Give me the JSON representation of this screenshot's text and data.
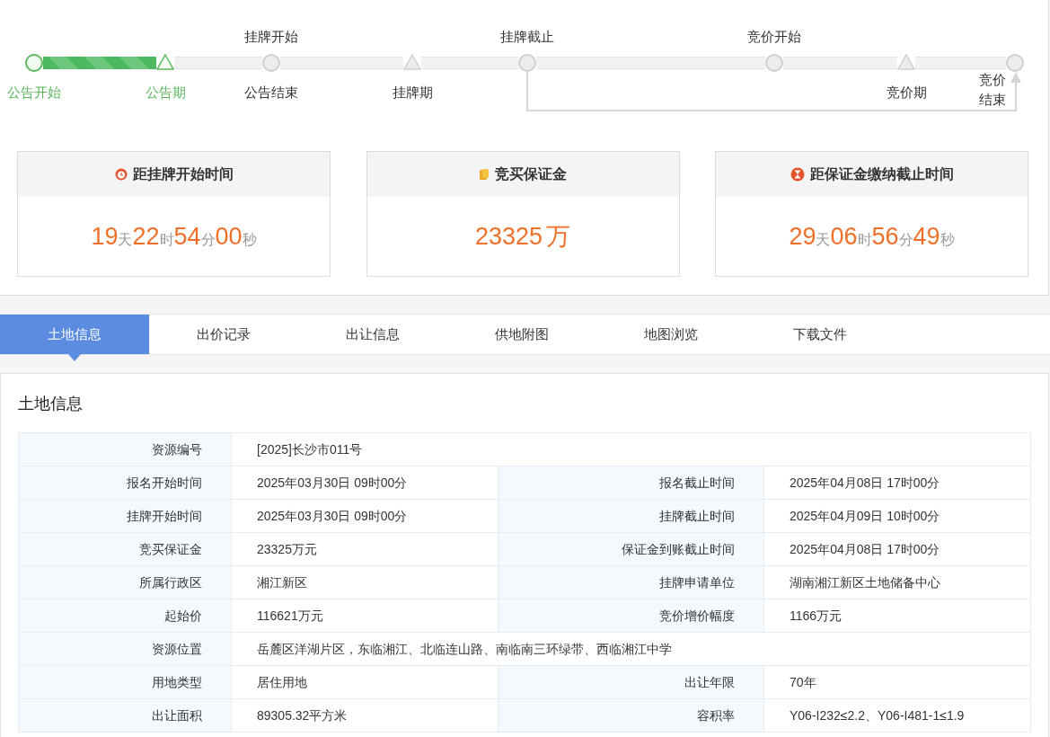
{
  "timeline": {
    "progress": {
      "level": 0.134
    },
    "nodes": [
      {
        "kind": "point",
        "below": "公告开始",
        "done": true
      },
      {
        "kind": "period",
        "below": "公告期",
        "done": true
      },
      {
        "kind": "point",
        "above": "挂牌开始",
        "below": "公告结束",
        "done": false
      },
      {
        "kind": "period",
        "below": "挂牌期",
        "done": false
      },
      {
        "kind": "point",
        "above": "挂牌截止",
        "done": false
      },
      {
        "kind": "point",
        "above": "竞价开始",
        "done": false
      },
      {
        "kind": "period",
        "below": "竞价期",
        "done": false
      },
      {
        "kind": "end",
        "below": "竞价结束",
        "done": false
      }
    ]
  },
  "cards": [
    {
      "kind": "countdown",
      "title": "距挂牌开始时间",
      "parts": [
        {
          "num": "19",
          "unit": "天"
        },
        {
          "num": "22",
          "unit": "时"
        },
        {
          "num": "54",
          "unit": "分"
        },
        {
          "num": "00",
          "unit": "秒"
        }
      ]
    },
    {
      "kind": "amount",
      "title": "竞买保证金",
      "parts": [
        {
          "num": "23325",
          "unit": "万"
        }
      ]
    },
    {
      "kind": "countdown",
      "title": "距保证金缴纳截止时间",
      "parts": [
        {
          "num": "29",
          "unit": "天"
        },
        {
          "num": "06",
          "unit": "时"
        },
        {
          "num": "56",
          "unit": "分"
        },
        {
          "num": "49",
          "unit": "秒"
        }
      ]
    }
  ],
  "tabs": [
    {
      "label": "土地信息",
      "selected": true
    },
    {
      "label": "出价记录",
      "selected": false
    },
    {
      "label": "出让信息",
      "selected": false
    },
    {
      "label": "供地附图",
      "selected": false
    },
    {
      "label": "地图浏览",
      "selected": false
    },
    {
      "label": "下载文件",
      "selected": false
    }
  ],
  "section_title": "土地信息",
  "table": {
    "rows": [
      [
        [
          "资源编号",
          "[2025]长沙市011号"
        ]
      ],
      [
        [
          "报名开始时间",
          "2025年03月30日 09时00分"
        ],
        [
          "报名截止时间",
          "2025年04月08日 17时00分"
        ]
      ],
      [
        [
          "挂牌开始时间",
          "2025年03月30日 09时00分"
        ],
        [
          "挂牌截止时间",
          "2025年04月09日 10时00分"
        ]
      ],
      [
        [
          "竞买保证金",
          "23325万元"
        ],
        [
          "保证金到账截止时间",
          "2025年04月08日 17时00分"
        ]
      ],
      [
        [
          "所属行政区",
          "湘江新区"
        ],
        [
          "挂牌申请单位",
          "湖南湘江新区土地储备中心"
        ]
      ],
      [
        [
          "起始价",
          "116621万元"
        ],
        [
          "竞价增价幅度",
          "1166万元"
        ]
      ],
      [
        [
          "资源位置",
          "岳麓区洋湖片区，东临湘江、北临连山路、南临南三环绿带、西临湘江中学"
        ]
      ],
      [
        [
          "用地类型",
          "居住用地"
        ],
        [
          "出让年限",
          "70年"
        ]
      ],
      [
        [
          "出让面积",
          "89305.32平方米"
        ],
        [
          "容积率",
          "Y06-I232≤2.2、Y06-I481-1≤1.9"
        ]
      ]
    ]
  }
}
